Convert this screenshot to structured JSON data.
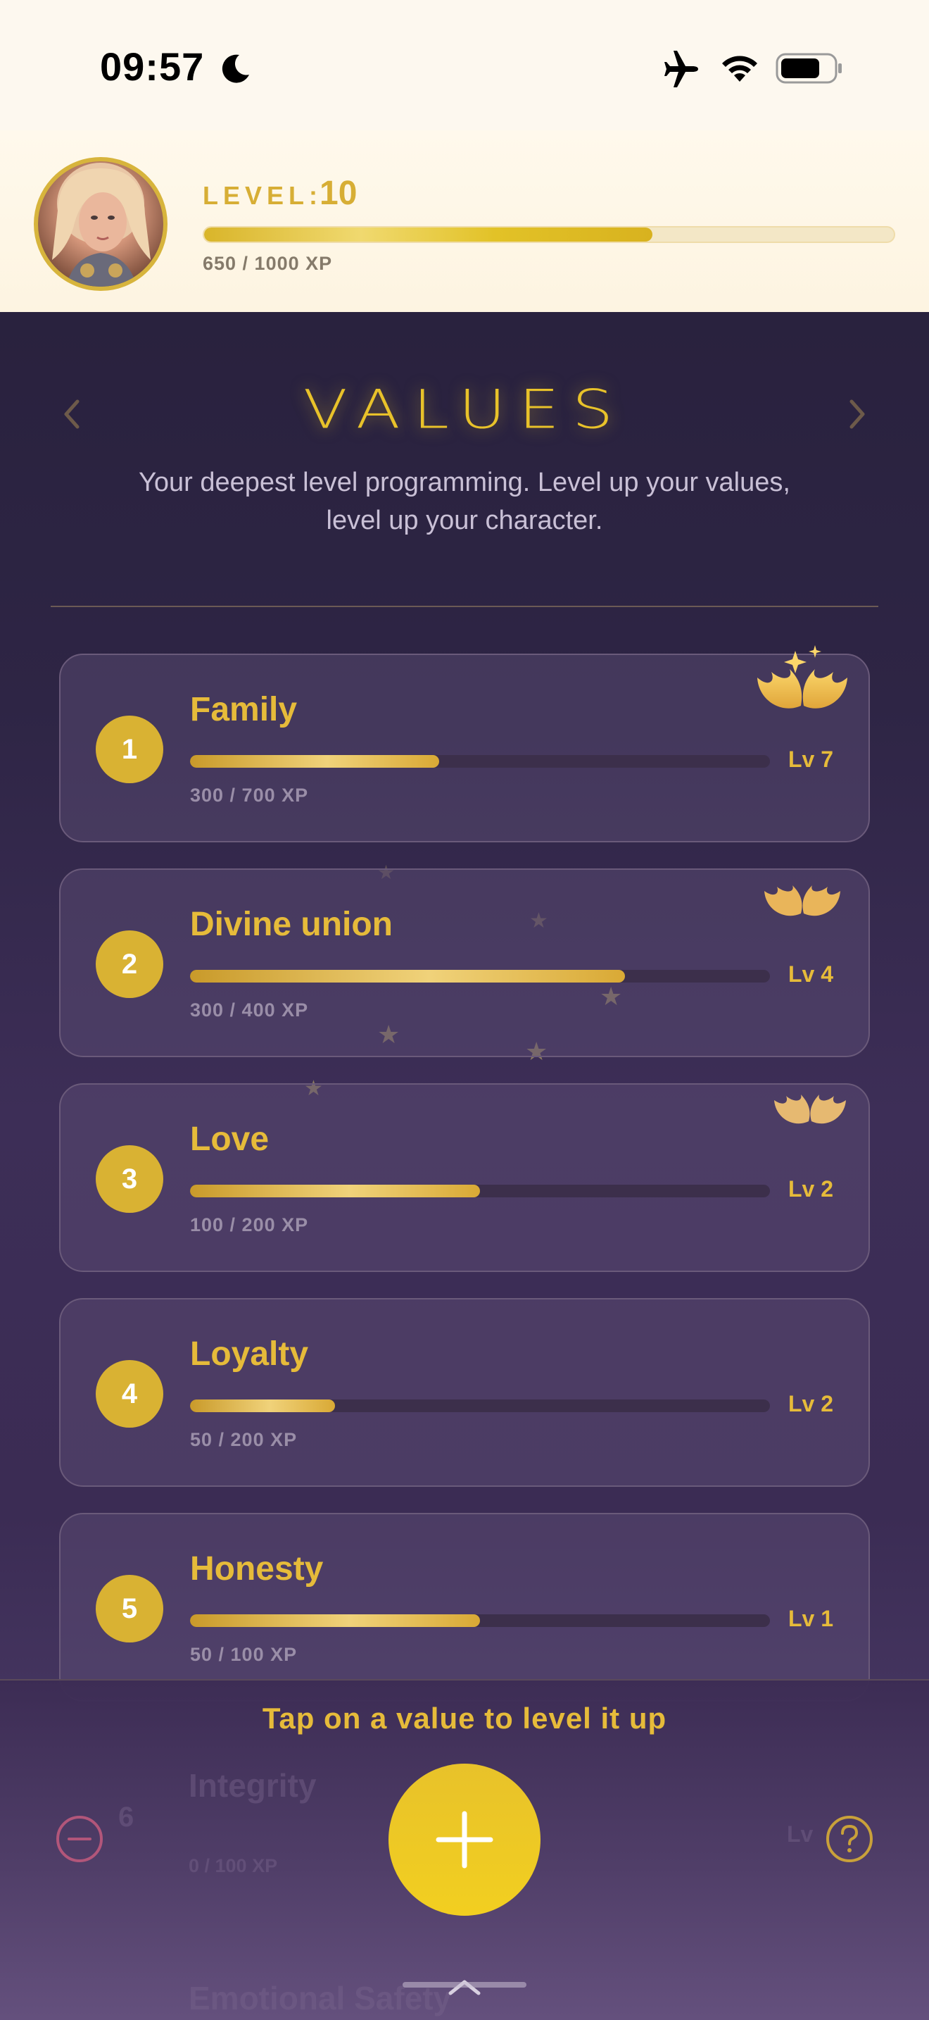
{
  "status_bar": {
    "time": "09:57"
  },
  "level": {
    "label": "LEVEL:",
    "value": "10",
    "xp_text": "650 / 1000 XP",
    "progress": 0.65
  },
  "screen": {
    "title": "VALUES",
    "subtitle": "Your deepest level programming. Level up your values, level up your character."
  },
  "values": [
    {
      "number": "1",
      "name": "Family",
      "xp_text": "300 / 700 XP",
      "level": "Lv 7",
      "progress": 0.43
    },
    {
      "number": "2",
      "name": "Divine union",
      "xp_text": "300 / 400 XP",
      "level": "Lv 4",
      "progress": 0.75
    },
    {
      "number": "3",
      "name": "Love",
      "xp_text": "100 / 200 XP",
      "level": "Lv 2",
      "progress": 0.5
    },
    {
      "number": "4",
      "name": "Loyalty",
      "xp_text": "50 / 200 XP",
      "level": "Lv 2",
      "progress": 0.25
    },
    {
      "number": "5",
      "name": "Honesty",
      "xp_text": "50 / 100 XP",
      "level": "Lv 1",
      "progress": 0.5
    }
  ],
  "hidden_values": {
    "item6_number": "6",
    "item6_name": "Integrity",
    "item6_xp": "0 / 100 XP",
    "item6_level": "Lv",
    "item7_name": "Emotional Safety"
  },
  "bottom": {
    "hint": "Tap on a value to level it up"
  },
  "icons": {
    "moon": "moon-icon",
    "airplane": "airplane-icon",
    "wifi": "wifi-icon",
    "battery": "battery-icon",
    "wings": "wings-icon",
    "add": "plus-icon",
    "remove": "minus-circle-icon",
    "help": "question-circle-icon",
    "chevron": "chevron-up-icon"
  },
  "colors": {
    "gold": "#e6bb3a",
    "accent_yellow": "#f2cf20",
    "remove_red": "#b2567a"
  }
}
